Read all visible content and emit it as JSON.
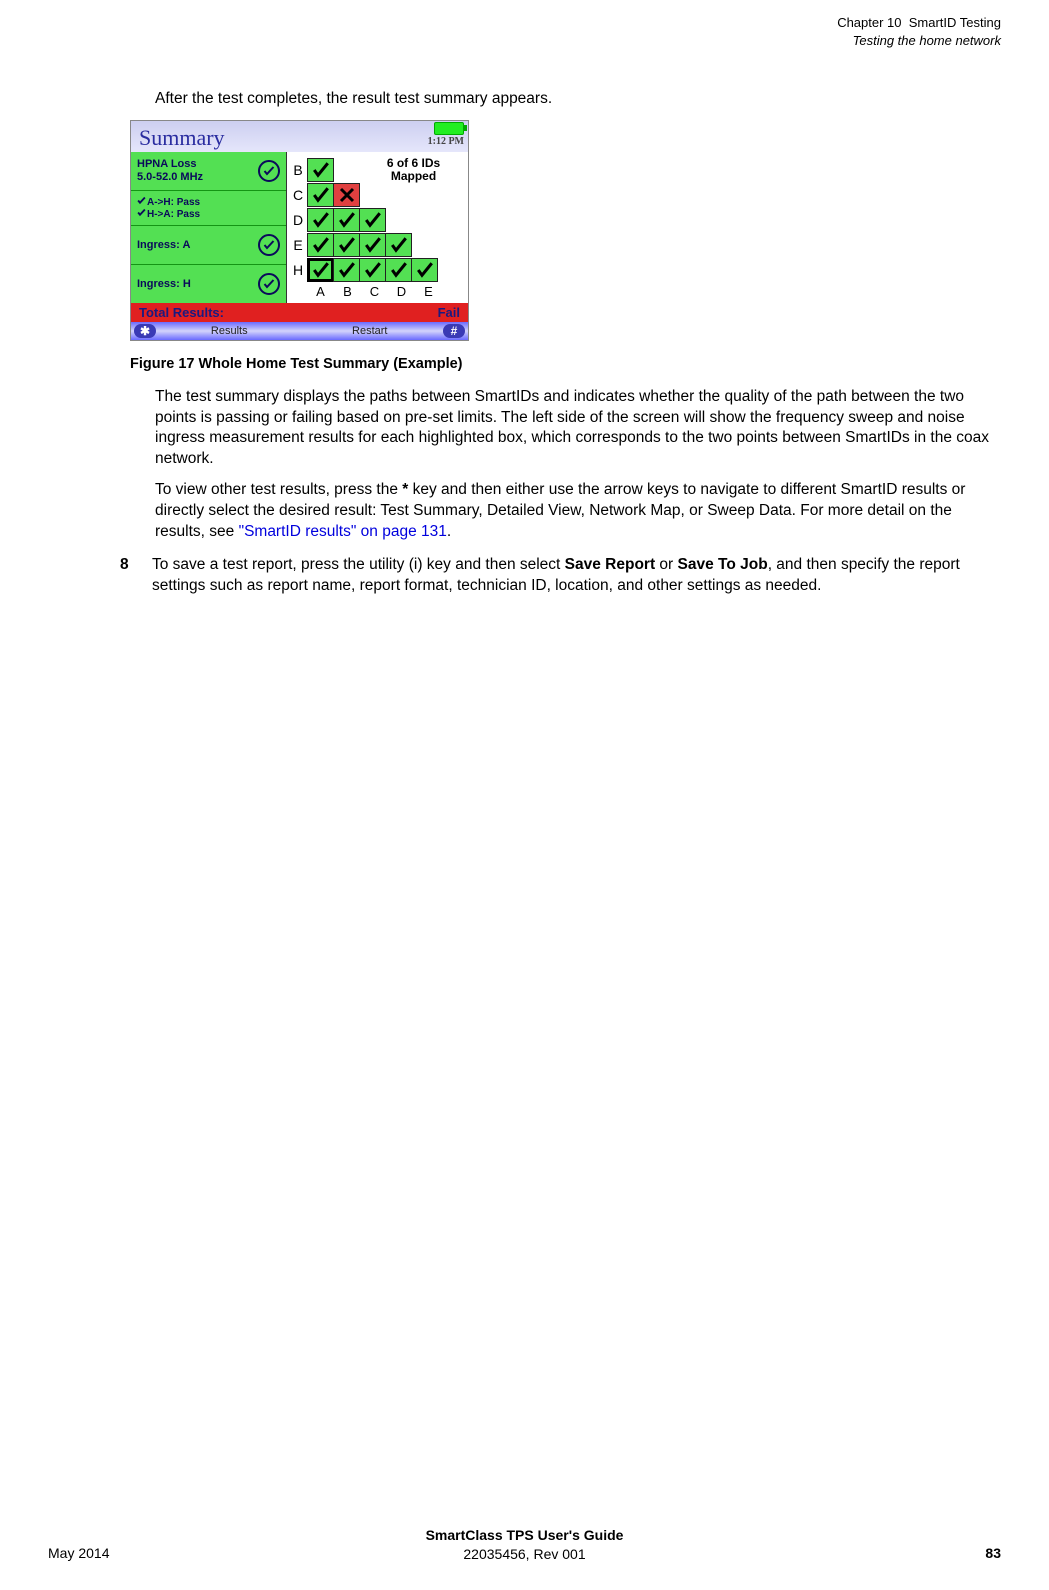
{
  "header": {
    "chapter": "Chapter 10",
    "chapterTitle": "SmartID Testing",
    "section": "Testing the home network"
  },
  "intro": "After the test completes, the result test summary appears.",
  "device": {
    "title": "Summary",
    "clock": "1:12 PM",
    "left": {
      "hpna1": "HPNA Loss",
      "hpna2": "5.0-52.0 MHz",
      "passAH": "A->H: Pass",
      "passHA": "H->A: Pass",
      "ingressA": "Ingress: A",
      "ingressH": "Ingress: H"
    },
    "mapped": "6 of 6 IDs Mapped",
    "rows": [
      "B",
      "C",
      "D",
      "E",
      "H"
    ],
    "cols": [
      "A",
      "B",
      "C",
      "D",
      "E"
    ],
    "totalLabel": "Total Results:",
    "totalValue": "Fail",
    "softLeft": "Results",
    "softRight": "Restart"
  },
  "figureCaption": "Figure 17  Whole Home Test Summary (Example)",
  "para1": "The test summary displays the paths between SmartIDs and indicates whether the quality of the path between the two points is passing or failing based on pre-set limits. The left side of the screen will show the frequency sweep and noise ingress measurement results for each highlighted box, which corresponds to the two points between SmartIDs in the coax network.",
  "para2a": "To view other test results, press the ",
  "para2star": "*",
  "para2b": " key and then either use the arrow keys to navigate to different SmartID results or directly select the desired result: Test Summary, Detailed View, Network Map, or Sweep Data. For more detail on the results, see ",
  "para2link": "\"SmartID results\" on page 131",
  "para2c": ".",
  "step8num": "8",
  "step8a": "To save a test report, press the utility (i) key and then select ",
  "step8b1": "Save Report",
  "step8or": " or ",
  "step8b2": "Save To Job",
  "step8c": ", and then specify the report settings such as report name, report format, technician ID, location, and other settings as needed.",
  "footer": {
    "date": "May 2014",
    "title": "SmartClass TPS User's Guide",
    "doc": "22035456, Rev 001",
    "page": "83"
  }
}
